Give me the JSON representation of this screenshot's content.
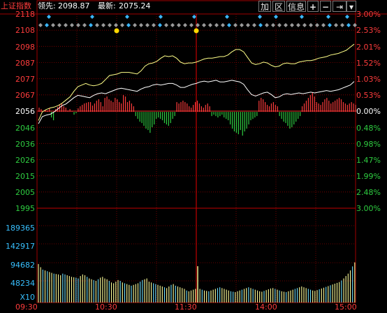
{
  "header": {
    "title": "上证指数",
    "lead_label": "领先:",
    "lead_value": "2098.87",
    "last_label": "最新:",
    "last_value": "2075.24"
  },
  "toolbar": {
    "add_label": "加",
    "zone_label": "区",
    "info_label": "信息",
    "zoom_in_label": "+",
    "zoom_out_label": "−",
    "end_label": "⇥",
    "menu_label": "▾"
  },
  "price_axis": {
    "left_labels": [
      "2118",
      "2108",
      "2098",
      "2087",
      "2077",
      "2067",
      "2056",
      "2046",
      "2036",
      "2026",
      "2015",
      "2005",
      "1995"
    ],
    "right_labels": [
      "3.00%",
      "2.53%",
      "2.01%",
      "1.52%",
      "1.03%",
      "0.53%",
      "0.00%",
      "0.48%",
      "0.98%",
      "1.47%",
      "1.99%",
      "2.48%",
      "3.00%"
    ]
  },
  "volume_axis": {
    "labels": [
      "189365",
      "142917",
      "94682",
      "48234"
    ],
    "unit": "X10"
  },
  "time_axis": {
    "labels": [
      "09:30",
      "10:30",
      "11:30",
      "14:00",
      "15:00"
    ]
  },
  "colors": {
    "up": "#ff3c3c",
    "down": "#2ecc40",
    "grid": "#8b0000",
    "index_line": "#ffffff",
    "lead_line": "#ffff88",
    "volume_bar": "#ffff9a",
    "volume_bar_alt": "#6fe0ff",
    "marker": "#ffd700",
    "diamond_blue": "#3ab7ff",
    "diamond_gray": "#9a9a9a"
  },
  "chart_data": {
    "type": "line",
    "base_price": 2056.0,
    "ylim": [
      1995,
      2118
    ],
    "time_ticks": [
      "09:30",
      "10:30",
      "11:30",
      "14:00",
      "15:00"
    ],
    "series": [
      {
        "name": "领先",
        "values": [
          2050.5,
          2056.0,
          2057.5,
          2058.5,
          2059.0,
          2060.0,
          2061.5,
          2063.5,
          2065.5,
          2069.0,
          2072.0,
          2073.0,
          2074.0,
          2073.0,
          2072.5,
          2073.0,
          2074.0,
          2076.5,
          2079.0,
          2079.5,
          2080.0,
          2081.0,
          2081.0,
          2081.0,
          2080.5,
          2080.0,
          2082.0,
          2085.0,
          2086.5,
          2087.0,
          2088.0,
          2090.0,
          2091.5,
          2091.0,
          2091.5,
          2090.0,
          2087.5,
          2086.5,
          2087.0,
          2087.0,
          2087.5,
          2088.5,
          2089.5,
          2090.0,
          2090.0,
          2090.5,
          2091.0,
          2091.0,
          2092.0,
          2094.0,
          2095.5,
          2095.5,
          2094.0,
          2090.5,
          2087.0,
          2086.0,
          2086.5,
          2087.5,
          2087.0,
          2085.5,
          2084.5,
          2085.0,
          2086.5,
          2087.0,
          2086.5,
          2086.5,
          2087.5,
          2088.0,
          2088.5,
          2088.5,
          2089.0,
          2090.0,
          2090.5,
          2091.0,
          2092.0,
          2092.5,
          2093.0,
          2094.0,
          2095.0,
          2097.0,
          2098.87
        ]
      },
      {
        "name": "最新",
        "values": [
          2048.5,
          2053.0,
          2054.0,
          2054.5,
          2056.0,
          2058.0,
          2060.0,
          2061.0,
          2063.0,
          2065.0,
          2066.5,
          2066.0,
          2065.5,
          2065.0,
          2066.5,
          2067.5,
          2068.0,
          2067.5,
          2068.5,
          2069.5,
          2070.5,
          2071.0,
          2070.5,
          2070.0,
          2069.5,
          2069.0,
          2070.5,
          2071.5,
          2072.0,
          2073.0,
          2073.5,
          2073.0,
          2073.5,
          2074.0,
          2074.0,
          2073.0,
          2071.5,
          2071.5,
          2072.5,
          2073.5,
          2074.0,
          2075.0,
          2075.5,
          2075.0,
          2075.5,
          2076.0,
          2075.0,
          2075.0,
          2075.5,
          2076.0,
          2075.5,
          2075.0,
          2073.5,
          2070.0,
          2067.0,
          2066.0,
          2067.0,
          2068.0,
          2068.5,
          2067.0,
          2065.0,
          2065.5,
          2067.0,
          2067.5,
          2067.0,
          2067.5,
          2068.0,
          2067.5,
          2068.0,
          2068.5,
          2068.0,
          2068.5,
          2069.0,
          2069.5,
          2069.0,
          2069.5,
          2070.0,
          2071.0,
          2072.0,
          2073.0,
          2075.24
        ]
      }
    ],
    "breadth_bars": [
      6,
      4,
      0,
      3,
      2,
      5,
      -8,
      -12,
      4,
      7,
      10,
      12,
      8,
      6,
      2,
      4,
      1,
      -4,
      -2,
      5,
      8,
      10,
      12,
      13,
      14,
      14,
      9,
      12,
      16,
      18,
      14,
      8,
      20,
      22,
      18,
      16,
      14,
      20,
      18,
      14,
      12,
      24,
      22,
      14,
      16,
      12,
      8,
      -6,
      -10,
      -14,
      -16,
      -20,
      -24,
      -26,
      -30,
      -22,
      -18,
      -10,
      -8,
      -10,
      -12,
      -16,
      -18,
      -20,
      -16,
      -10,
      -6,
      14,
      12,
      14,
      16,
      14,
      12,
      8,
      6,
      10,
      14,
      16,
      12,
      8,
      6,
      10,
      12,
      8,
      -6,
      -4,
      -6,
      -8,
      -6,
      -4,
      -8,
      -10,
      -12,
      -18,
      -24,
      -28,
      -30,
      -32,
      -26,
      -34,
      -28,
      -24,
      -18,
      -12,
      -10,
      -8,
      -6,
      16,
      20,
      18,
      14,
      10,
      8,
      12,
      14,
      10,
      8,
      -6,
      -10,
      -14,
      -16,
      -20,
      -24,
      -22,
      -18,
      -14,
      -10,
      -6,
      8,
      12,
      16,
      20,
      24,
      28,
      22,
      14,
      12,
      10,
      14,
      18,
      20,
      16,
      12,
      14,
      16,
      18,
      20,
      18,
      14,
      12,
      10,
      12,
      14,
      12,
      10
    ],
    "volume_ylim": [
      0,
      235000
    ],
    "volume": [
      96000,
      88000,
      82000,
      80000,
      78000,
      76000,
      74000,
      72000,
      71000,
      70000,
      68000,
      72000,
      70000,
      68000,
      66000,
      64000,
      63000,
      62000,
      60000,
      66000,
      70000,
      68000,
      64000,
      60000,
      58000,
      56000,
      54000,
      58000,
      62000,
      64000,
      60000,
      58000,
      54000,
      50000,
      48000,
      52000,
      56000,
      54000,
      50000,
      48000,
      46000,
      44000,
      42000,
      44000,
      46000,
      48000,
      52000,
      56000,
      58000,
      60000,
      52000,
      50000,
      48000,
      46000,
      44000,
      42000,
      40000,
      38000,
      36000,
      40000,
      44000,
      46000,
      42000,
      40000,
      38000,
      36000,
      34000,
      30000,
      28000,
      30000,
      32000,
      34000,
      36000,
      34000,
      32000,
      30000,
      29000,
      28000,
      30000,
      32000,
      34000,
      36000,
      38000,
      36000,
      34000,
      32000,
      30000,
      28000,
      27000,
      26000,
      28000,
      30000,
      32000,
      34000,
      36000,
      38000,
      36000,
      34000,
      32000,
      30000,
      28000,
      27000,
      29000,
      31000,
      33000,
      35000,
      36000,
      34000,
      32000,
      30000,
      28000,
      27000,
      26000,
      28000,
      30000,
      32000,
      34000,
      36000,
      38000,
      40000,
      38000,
      36000,
      34000,
      32000,
      30000,
      29000,
      31000,
      33000,
      35000,
      37000,
      39000,
      41000,
      43000,
      45000,
      47000,
      49000,
      51000,
      55000,
      60000,
      66000,
      72000,
      80000,
      90000,
      100000
    ]
  }
}
